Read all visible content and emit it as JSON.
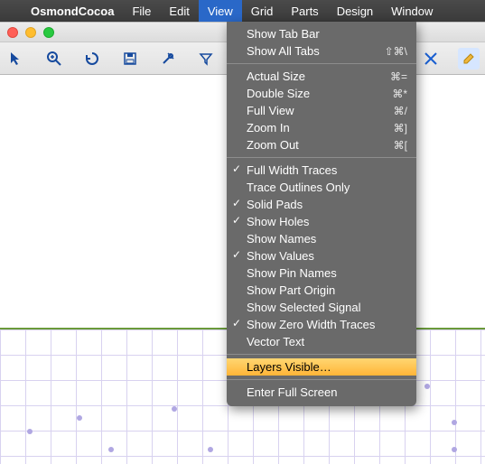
{
  "menubar": {
    "app": "OsmondCocoa",
    "items": [
      "File",
      "Edit",
      "View",
      "Grid",
      "Parts",
      "Design",
      "Window"
    ],
    "open_index": 2
  },
  "view_menu": {
    "groups": [
      [
        {
          "label": "Show Tab Bar",
          "checked": false,
          "shortcut": ""
        },
        {
          "label": "Show All Tabs",
          "checked": false,
          "shortcut": "⇧⌘\\"
        }
      ],
      [
        {
          "label": "Actual Size",
          "checked": false,
          "shortcut": "⌘="
        },
        {
          "label": "Double Size",
          "checked": false,
          "shortcut": "⌘*"
        },
        {
          "label": "Full View",
          "checked": false,
          "shortcut": "⌘/"
        },
        {
          "label": "Zoom In",
          "checked": false,
          "shortcut": "⌘]"
        },
        {
          "label": "Zoom Out",
          "checked": false,
          "shortcut": "⌘["
        }
      ],
      [
        {
          "label": "Full Width Traces",
          "checked": true,
          "shortcut": ""
        },
        {
          "label": "Trace Outlines Only",
          "checked": false,
          "shortcut": ""
        },
        {
          "label": "Solid Pads",
          "checked": true,
          "shortcut": ""
        },
        {
          "label": "Show Holes",
          "checked": true,
          "shortcut": ""
        },
        {
          "label": "Show Names",
          "checked": false,
          "shortcut": ""
        },
        {
          "label": "Show Values",
          "checked": true,
          "shortcut": ""
        },
        {
          "label": "Show Pin Names",
          "checked": false,
          "shortcut": ""
        },
        {
          "label": "Show Part Origin",
          "checked": false,
          "shortcut": ""
        },
        {
          "label": "Show Selected Signal",
          "checked": false,
          "shortcut": ""
        },
        {
          "label": "Show Zero Width Traces",
          "checked": true,
          "shortcut": ""
        },
        {
          "label": "Vector Text",
          "checked": false,
          "shortcut": ""
        }
      ],
      [
        {
          "label": "Layers Visible…",
          "checked": false,
          "shortcut": "",
          "highlight": true
        }
      ],
      [
        {
          "label": "Enter Full Screen",
          "checked": false,
          "shortcut": ""
        }
      ]
    ]
  },
  "toolbar": {
    "tools": [
      "pointer-tool",
      "zoom-tool",
      "rotate-tool",
      "save-tool",
      "pin-tool",
      "filter-tool",
      "measure-tool",
      "cut-tool",
      "edit-tool"
    ]
  }
}
